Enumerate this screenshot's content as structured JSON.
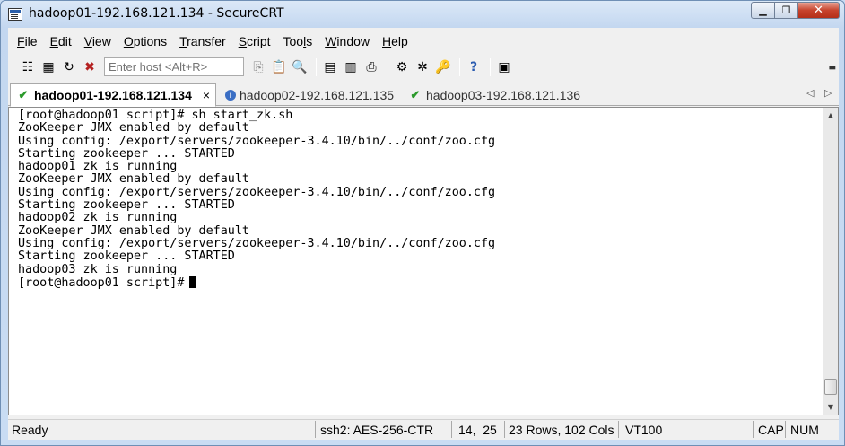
{
  "window": {
    "title": "hadoop01-192.168.121.134 - SecureCRT"
  },
  "menu": [
    "File",
    "Edit",
    "View",
    "Options",
    "Transfer",
    "Script",
    "Tools",
    "Window",
    "Help"
  ],
  "menu_underline": [
    "F",
    "E",
    "V",
    "O",
    "T",
    "S",
    "l",
    "W",
    "H"
  ],
  "toolbar": {
    "host_placeholder": "Enter host <Alt+R>"
  },
  "tabs": [
    {
      "label": "hadoop01-192.168.121.134",
      "icon": "check-icon",
      "active": true,
      "close": "×"
    },
    {
      "label": "hadoop02-192.168.121.135",
      "icon": "info-icon",
      "active": false
    },
    {
      "label": "hadoop03-192.168.121.136",
      "icon": "check-icon",
      "active": false
    }
  ],
  "terminal": {
    "lines": [
      "[root@hadoop01 script]# sh start_zk.sh",
      "ZooKeeper JMX enabled by default",
      "Using config: /export/servers/zookeeper-3.4.10/bin/../conf/zoo.cfg",
      "Starting zookeeper ... STARTED",
      "hadoop01 zk is running",
      "ZooKeeper JMX enabled by default",
      "Using config: /export/servers/zookeeper-3.4.10/bin/../conf/zoo.cfg",
      "Starting zookeeper ... STARTED",
      "hadoop02 zk is running",
      "ZooKeeper JMX enabled by default",
      "Using config: /export/servers/zookeeper-3.4.10/bin/../conf/zoo.cfg",
      "Starting zookeeper ... STARTED",
      "hadoop03 zk is running"
    ],
    "prompt": "[root@hadoop01 script]#"
  },
  "status": {
    "ready": "Ready",
    "protocol": "ssh2: AES-256-CTR",
    "position": "14,  25",
    "size": "23 Rows, 102 Cols",
    "emulation": "VT100",
    "caps": "CAP",
    "num": "NUM"
  }
}
